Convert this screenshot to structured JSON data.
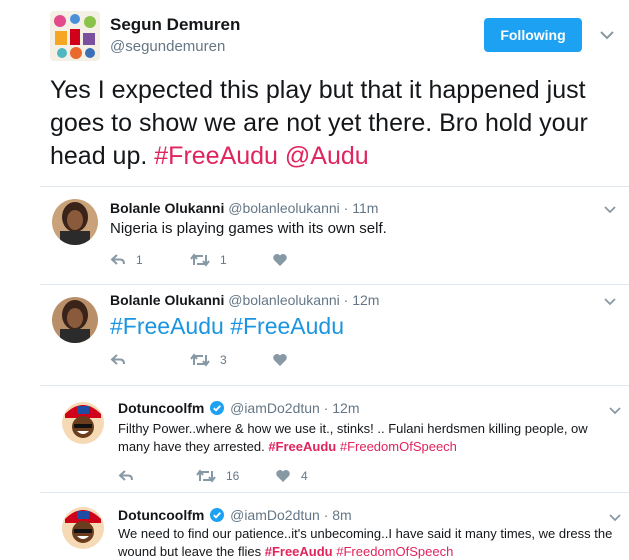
{
  "main_tweet": {
    "name": "Segun Demuren",
    "handle": "@segundemuren",
    "follow_label": "Following",
    "text_plain": "Yes I expected this play but that it happened just goes to show we are not yet there. Bro hold your head up. ",
    "hashtag": "#FreeAudu",
    "mention": "@Audu"
  },
  "replies": [
    {
      "name": "Bolanle Olukanni",
      "handle": "@bolanleolukanni",
      "time": "· 11m",
      "text": "Nigeria is playing games with its own self.",
      "reply_count": "1",
      "retweet_count": "1",
      "like_count": ""
    },
    {
      "name": "Bolanle Olukanni",
      "handle": "@bolanleolukanni",
      "time": "· 12m",
      "text": "#FreeAudu #FreeAudu",
      "reply_count": "",
      "retweet_count": "3",
      "like_count": ""
    },
    {
      "name": "Dotuncoolfm",
      "handle": "@iamDo2dtun",
      "time": "· 12m",
      "text_plain": "Filthy Power..where & how we use it., stinks! .. Fulani herdsmen killing people, ow many have they arrested. ",
      "hashtag1": "#FreeAudu",
      "hashtag2": "#FreedomOfSpeech",
      "reply_count": "",
      "retweet_count": "16",
      "like_count": "4"
    },
    {
      "name": "Dotuncoolfm",
      "handle": "@iamDo2dtun",
      "time": "· 8m",
      "text_plain": "We need to find our patience..it's unbecoming..I have said it many times, we dress the wound but leave the flies ",
      "hashtag1": "#FreeAudu",
      "hashtag2": "#FreedomOfSpeech"
    }
  ],
  "colors": {
    "accent": "#1da1f2",
    "hashtag": "#e0245e",
    "blue_hashtag": "#1b95e0",
    "muted": "#657786"
  }
}
